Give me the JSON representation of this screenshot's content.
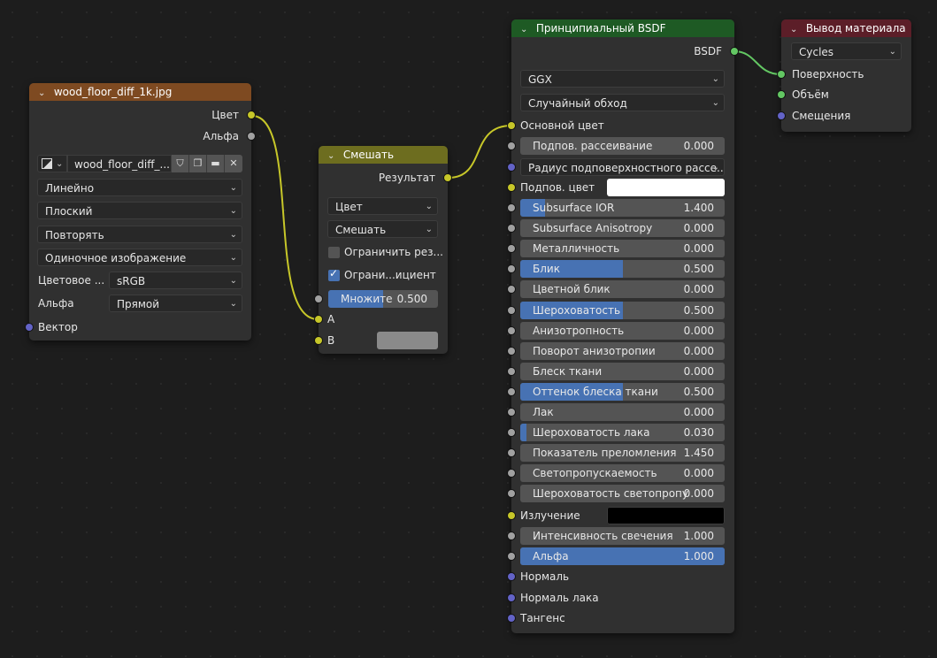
{
  "image_node": {
    "title": "wood_floor_diff_1k.jpg",
    "header_color": "#7e4a21",
    "outputs": [
      "Цвет",
      "Альфа"
    ],
    "image_name": "wood_floor_diff_...",
    "interpolation": "Линейно",
    "projection": "Плоский",
    "extension": "Повторять",
    "source": "Одиночное изображение",
    "color_space_label": "Цветовое ...",
    "color_space_value": "sRGB",
    "alpha_label": "Альфа",
    "alpha_value": "Прямой",
    "vector_input": "Вектор"
  },
  "mix_node": {
    "title": "Смешать",
    "header_color": "#6d6d1f",
    "output": "Результат",
    "data_type": "Цвет",
    "blend_mode": "Смешать",
    "clamp_result_label": "Ограничить рез...",
    "clamp_result_checked": false,
    "clamp_factor_label": "Ограни...ициент",
    "clamp_factor_checked": true,
    "factor_label": "Множите",
    "factor_value": "0.500",
    "factor_fraction": 0.5,
    "input_a": "A",
    "input_b": "B",
    "b_color": "#8a8a8a"
  },
  "bsdf_node": {
    "title": "Принципиальный BSDF",
    "header_color": "#1e5a24",
    "output": "BSDF",
    "distribution": "GGX",
    "subsurface_method": "Случайный обход",
    "base_color_label": "Основной цвет",
    "subsurface_scattering": {
      "label": "Подпов. рассеивание",
      "value": "0.000",
      "fraction": 0
    },
    "subsurface_radius": "Радиус подповерхностного рассе...",
    "subsurface_color_label": "Подпов. цвет",
    "subsurface_color": "#ffffff",
    "sliders": [
      {
        "label": "Subsurface IOR",
        "value": "1.400",
        "fraction": 0.12
      },
      {
        "label": "Subsurface Anisotropy",
        "value": "0.000",
        "fraction": 0
      },
      {
        "label": "Металличность",
        "value": "0.000",
        "fraction": 0
      },
      {
        "label": "Блик",
        "value": "0.500",
        "fraction": 0.5
      },
      {
        "label": "Цветной блик",
        "value": "0.000",
        "fraction": 0
      },
      {
        "label": "Шероховатость",
        "value": "0.500",
        "fraction": 0.5
      },
      {
        "label": "Анизотропность",
        "value": "0.000",
        "fraction": 0
      },
      {
        "label": "Поворот анизотропии",
        "value": "0.000",
        "fraction": 0
      },
      {
        "label": "Блеск ткани",
        "value": "0.000",
        "fraction": 0
      },
      {
        "label": "Оттенок блеска ткани",
        "value": "0.500",
        "fraction": 0.5
      },
      {
        "label": "Лак",
        "value": "0.000",
        "fraction": 0
      },
      {
        "label": "Шероховатость лака",
        "value": "0.030",
        "fraction": 0.03
      },
      {
        "label": "Показатель преломления",
        "value": "1.450",
        "fraction": 0
      },
      {
        "label": "Светопропускаемость",
        "value": "0.000",
        "fraction": 0
      },
      {
        "label": "Шероховатость светопропу",
        "value": "0.000",
        "fraction": 0
      }
    ],
    "emission_label": "Излучение",
    "emission_color": "#000000",
    "emission_strength": {
      "label": "Интенсивность свечения",
      "value": "1.000",
      "fraction": 0
    },
    "alpha": {
      "label": "Альфа",
      "value": "1.000",
      "fraction": 1
    },
    "normal": "Нормаль",
    "clearcoat_normal": "Нормаль лака",
    "tangent": "Тангенс"
  },
  "output_node": {
    "title": "Вывод материала",
    "header_color": "#5c1e28",
    "target": "Cycles",
    "inputs": [
      "Поверхность",
      "Объём",
      "Смещения"
    ]
  },
  "colors": {
    "socket_color": "#c7c729",
    "socket_float": "#a1a1a1",
    "socket_vector": "#6363c7",
    "socket_shader": "#63c763",
    "slider_fill": "#4772b3"
  }
}
